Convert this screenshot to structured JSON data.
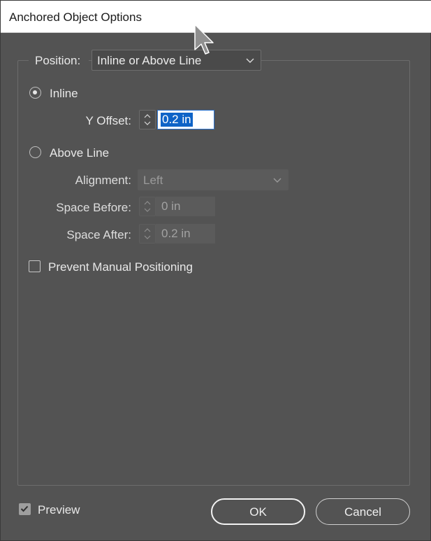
{
  "window": {
    "title": "Anchored Object Options"
  },
  "position": {
    "label": "Position:",
    "value": "Inline or Above Line"
  },
  "inline": {
    "label": "Inline",
    "selected": true
  },
  "y_offset": {
    "label": "Y Offset:",
    "value": "0.2 in"
  },
  "above_line": {
    "label": "Above Line",
    "selected": false,
    "alignment_label": "Alignment:",
    "alignment_value": "Left",
    "space_before_label": "Space Before:",
    "space_before_value": "0 in",
    "space_after_label": "Space After:",
    "space_after_value": "0.2 in"
  },
  "prevent_manual": {
    "label": "Prevent Manual Positioning",
    "checked": false
  },
  "footer": {
    "preview_label": "Preview",
    "preview_checked": true,
    "ok_label": "OK",
    "cancel_label": "Cancel"
  },
  "icons": {
    "cursor": "arrow-pointer-icon",
    "chevron": "chevron-down-icon",
    "stepper": "stepper-icon",
    "check": "checkmark-icon"
  }
}
